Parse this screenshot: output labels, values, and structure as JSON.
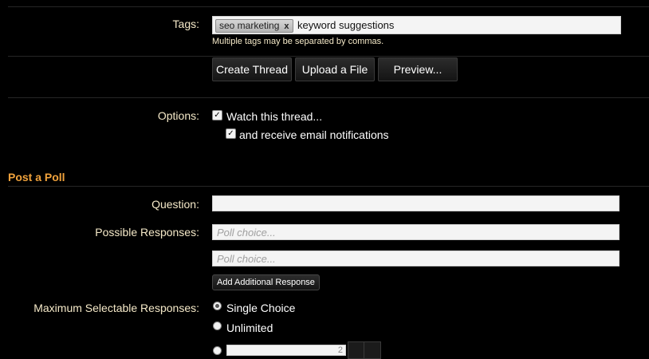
{
  "tags": {
    "label": "Tags:",
    "chip_text": "seo marketing",
    "chip_remove": "x",
    "current_text": "keyword suggestions",
    "hint": "Multiple tags may be separated by commas."
  },
  "buttons": {
    "create": "Create Thread",
    "upload": "Upload a File",
    "preview": "Preview..."
  },
  "options": {
    "label": "Options:",
    "watch_label": "Watch this thread...",
    "watch_checked": true,
    "email_label": "and receive email notifications",
    "email_checked": true
  },
  "poll": {
    "section_title": "Post a Poll",
    "question_label": "Question:",
    "question_value": "",
    "responses_label": "Possible Responses:",
    "choice_placeholder": "Poll choice...",
    "add_response": "Add Additional Response",
    "max_label": "Maximum Selectable Responses:",
    "single_choice": "Single Choice",
    "unlimited": "Unlimited",
    "selected": "single",
    "custom_value": "2"
  }
}
